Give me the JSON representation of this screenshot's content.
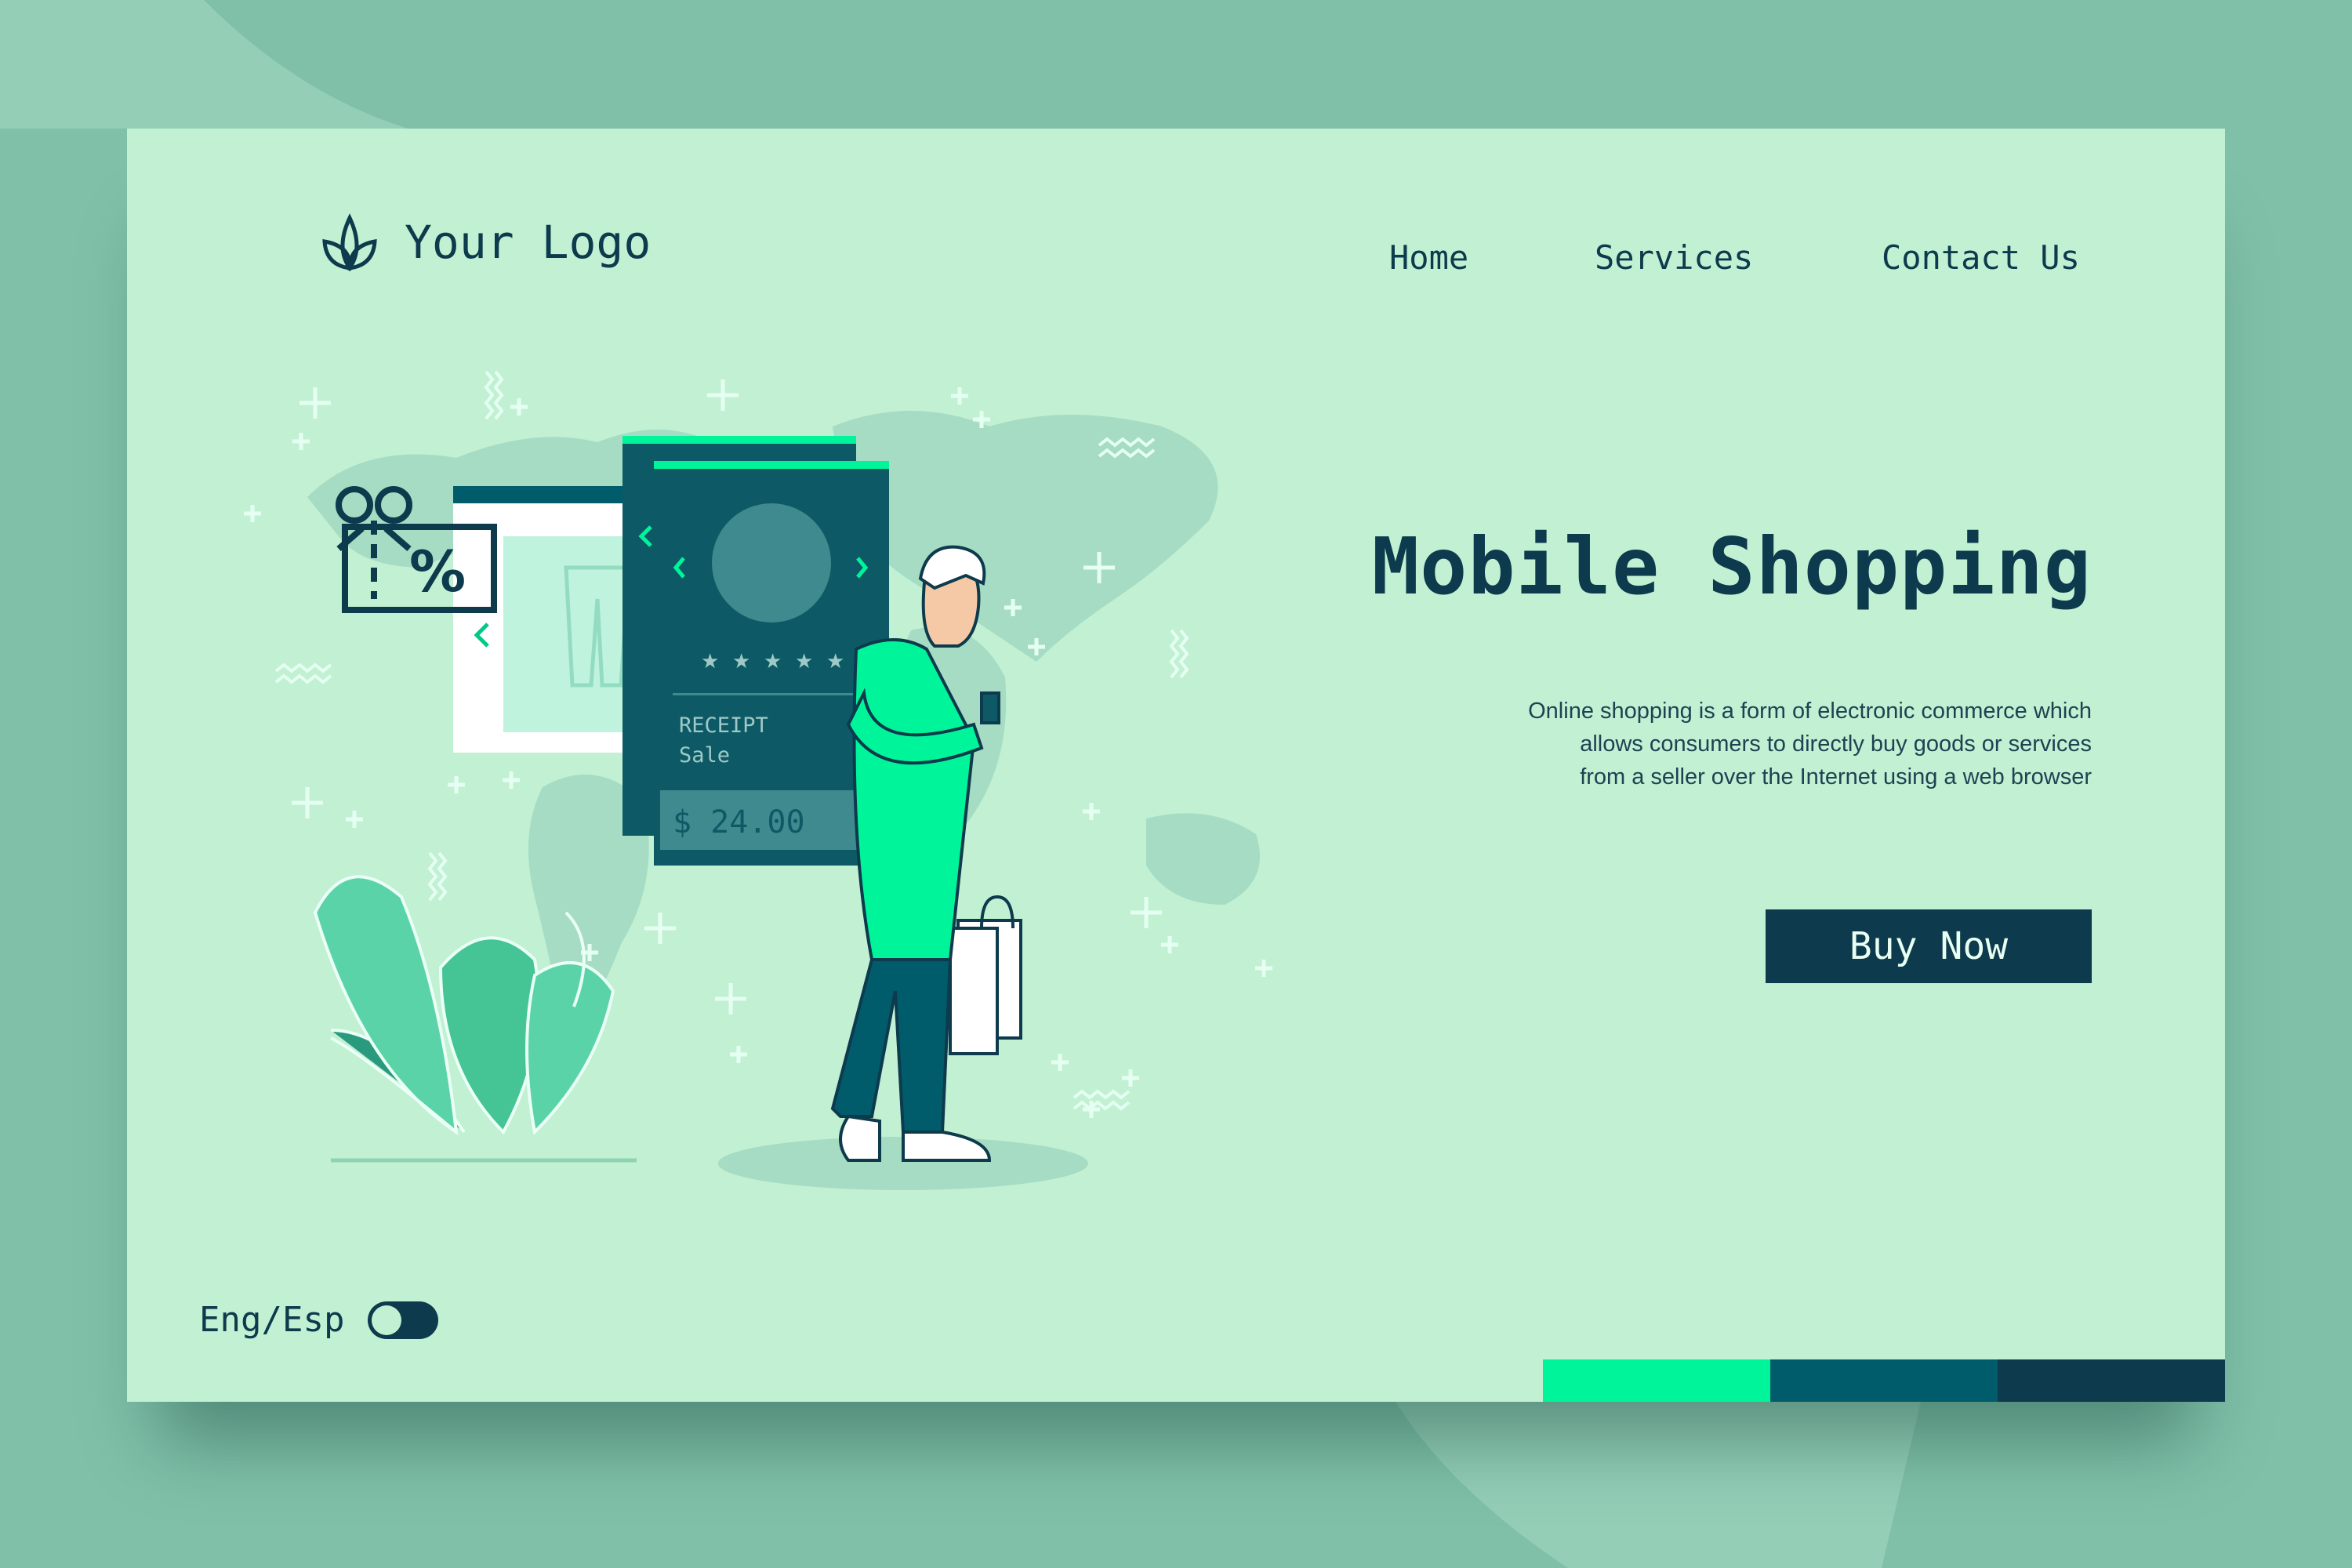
{
  "brand": {
    "logo_text": "Your Logo"
  },
  "nav": {
    "home": "Home",
    "services": "Services",
    "contact": "Contact Us"
  },
  "hero": {
    "title": "Mobile Shopping",
    "description_lines": [
      "Online shopping is a form of electronic commerce which",
      "allows consumers to directly buy goods or services",
      "from a seller over the Internet using a web browser"
    ],
    "cta": "Buy Now"
  },
  "language": {
    "label": "Eng/Esp"
  },
  "illustration": {
    "receipt_label": "RECEIPT",
    "receipt_sub": "Sale",
    "price": "$ 24.00",
    "gift_symbol": "%"
  },
  "colors": {
    "page_bg": "#80c0a9",
    "card_bg": "#c1f0d3",
    "primary": "#0d3a4c",
    "accent": "#00f59a",
    "teal": "#005c6b"
  },
  "icons": [
    "leaf-logo-icon",
    "gift-percent-icon",
    "chevron-left-icon",
    "chevron-right-icon",
    "star-icon",
    "plus-icon",
    "wave-icon"
  ]
}
